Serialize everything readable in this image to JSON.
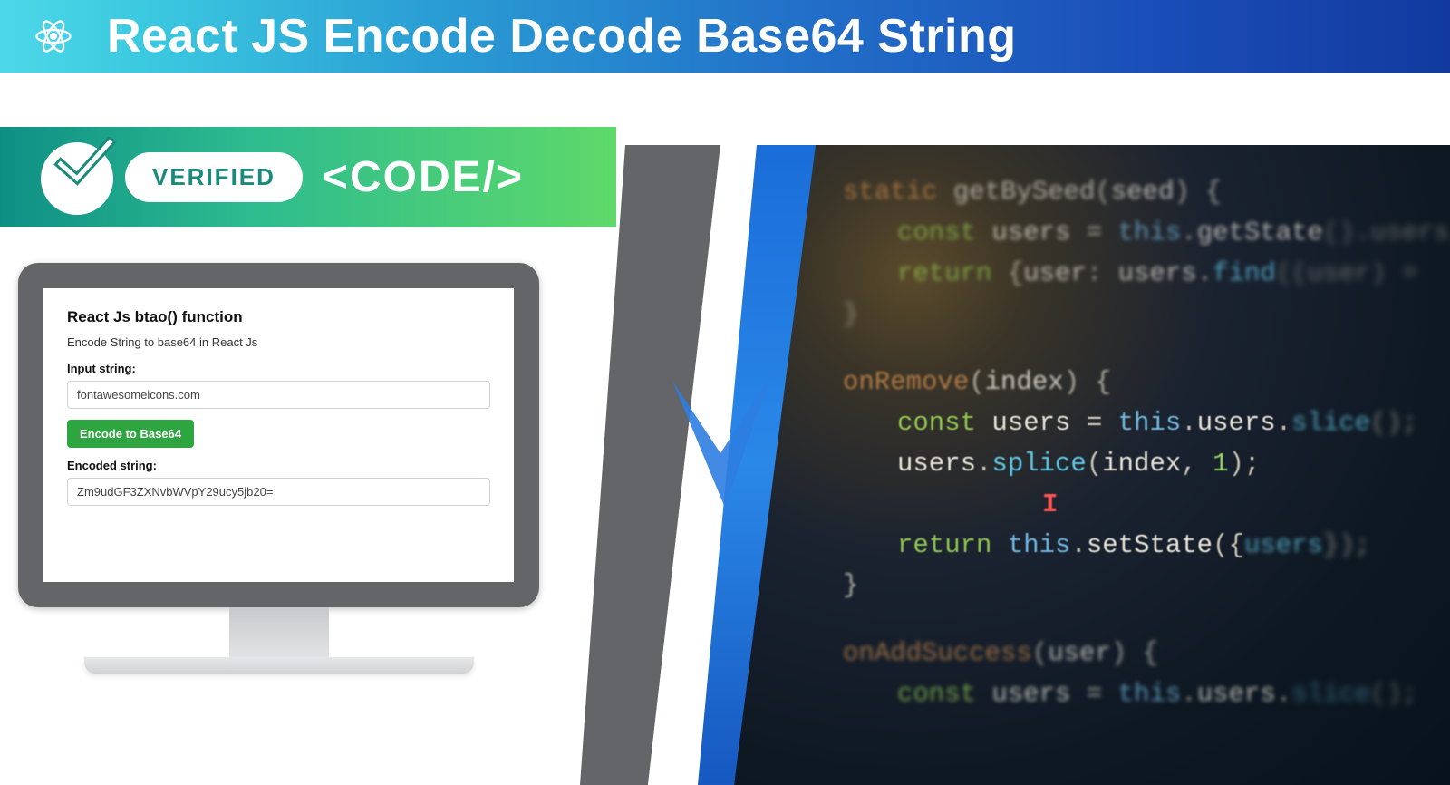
{
  "header": {
    "title": "React JS Encode Decode Base64 String"
  },
  "badge": {
    "verified_label": "VERIFIED",
    "code_label": "<CODE/>"
  },
  "monitor": {
    "title": "React Js btao() function",
    "subtitle": "Encode String to base64 in React Js",
    "input_label": "Input string:",
    "input_value": "fontawesomeicons.com",
    "button_label": "Encode to Base64",
    "output_label": "Encoded string:",
    "output_value": "Zm9udGF3ZXNvbWVpY29ucy5jb20="
  },
  "code": {
    "line1": {
      "kw": "static",
      "fn": "getBySeed",
      "arg": "seed"
    },
    "line2": {
      "kw": "const",
      "id": "users",
      "this": "this",
      "method": "getState"
    },
    "line3": {
      "kw": "return",
      "prop": "user",
      "id": "users",
      "method": "find",
      "arg": "user"
    },
    "line4": {
      "fn": "onRemove",
      "arg": "index"
    },
    "line5": {
      "kw": "const",
      "id": "users",
      "this": "this",
      "prop": "users",
      "method": "slice"
    },
    "line6": {
      "id": "users",
      "method": "splice",
      "arg": "index",
      "num": "1"
    },
    "line7": {
      "kw": "return",
      "this": "this",
      "method": "setState",
      "id": "users"
    },
    "line8": {
      "fn": "onAddSuccess",
      "arg": "user"
    },
    "line9": {
      "kw": "const",
      "id": "users",
      "this": "this",
      "prop": "users",
      "method": "slice"
    }
  }
}
